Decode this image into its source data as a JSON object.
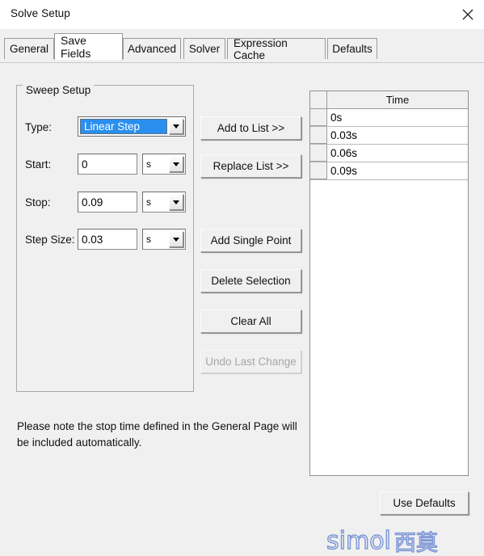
{
  "window": {
    "title": "Solve Setup",
    "close_icon": "close-icon"
  },
  "tabs": [
    {
      "label": "General",
      "active": false
    },
    {
      "label": "Save Fields",
      "active": true
    },
    {
      "label": "Advanced",
      "active": false
    },
    {
      "label": "Solver",
      "active": false
    },
    {
      "label": "Expression Cache",
      "active": false
    },
    {
      "label": "Defaults",
      "active": false
    }
  ],
  "sweep_setup": {
    "legend": "Sweep Setup",
    "type": {
      "label": "Type:",
      "value": "Linear Step",
      "arrow_icon": "chevron-down-icon"
    },
    "start": {
      "label": "Start:",
      "value": "0",
      "unit": "s",
      "arrow_icon": "chevron-down-icon"
    },
    "stop": {
      "label": "Stop:",
      "value": "0.09",
      "unit": "s",
      "arrow_icon": "chevron-down-icon"
    },
    "step_size": {
      "label": "Step Size:",
      "value": "0.03",
      "unit": "s",
      "arrow_icon": "chevron-down-icon"
    }
  },
  "actions": {
    "add_to_list": "Add to List >>",
    "replace_list": "Replace List >>",
    "add_single_point": "Add Single Point",
    "delete_selection": "Delete Selection",
    "clear_all": "Clear All",
    "undo_last_change": "Undo Last Change"
  },
  "grid": {
    "column_header": "Time",
    "rows": [
      {
        "time": "0s"
      },
      {
        "time": "0.03s"
      },
      {
        "time": "0.06s"
      },
      {
        "time": "0.09s"
      }
    ]
  },
  "note": "Please note the stop time defined in the General Page will be included automatically.",
  "footer": {
    "use_defaults": "Use Defaults"
  },
  "watermark": {
    "latin": "simol",
    "cjk": "西莫",
    "color": "#7b95d6"
  }
}
